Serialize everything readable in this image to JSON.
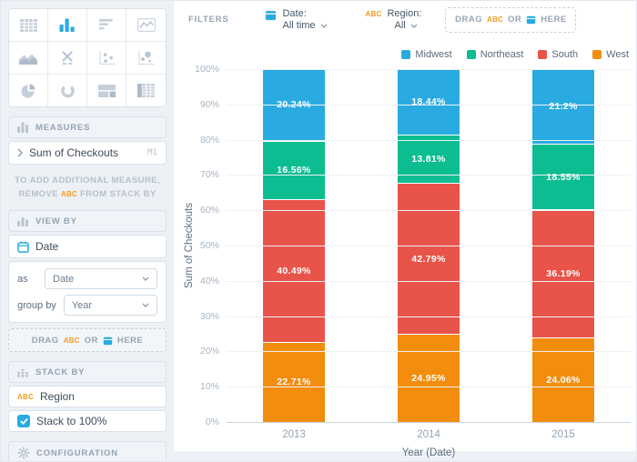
{
  "colors": {
    "accent_blue": "#29abe2",
    "accent_orange": "#f59b22",
    "midwest": "#29abe2",
    "northeast": "#0dbd92",
    "south": "#e8534a",
    "west": "#f28d0e"
  },
  "sidebar": {
    "chart_types": [
      "table",
      "bar",
      "horizontal-bar",
      "line",
      "area",
      "boxplot",
      "scatter",
      "bubble",
      "pie",
      "donut",
      "treemap",
      "pivot-table"
    ],
    "active_chart_type": "bar",
    "measures": {
      "title": "MEASURES",
      "item": "Sum of Checkouts",
      "badge": "M1"
    },
    "note": {
      "line1": "TO ADD ADDITIONAL MEASURE,",
      "line2_pre": "REMOVE",
      "abc": "ABC",
      "line2_post": "FROM STACK BY"
    },
    "view_by": {
      "title": "VIEW BY",
      "field": "Date",
      "as_label": "as",
      "as_value": "Date",
      "group_by_label": "group by",
      "group_by_value": "Year",
      "drop": {
        "drag": "DRAG",
        "abc": "ABC",
        "or": "OR",
        "here": "HERE"
      }
    },
    "stack_by": {
      "title": "STACK BY",
      "abc": "ABC",
      "field": "Region",
      "checkbox_label": "Stack to 100%",
      "checked": true
    },
    "configuration": {
      "title": "CONFIGURATION"
    }
  },
  "filters_bar": {
    "title": "FILTERS",
    "date_filter": {
      "label": "Date:",
      "value": "All time"
    },
    "region_filter": {
      "abc": "ABC",
      "label": "Region:",
      "value": "All"
    },
    "drop": {
      "drag": "DRAG",
      "abc": "ABC",
      "or": "OR",
      "here": "HERE"
    }
  },
  "chart_data": {
    "type": "bar",
    "stacked_to_100": true,
    "categories": [
      "2013",
      "2014",
      "2015"
    ],
    "series": [
      {
        "name": "Midwest",
        "color": "#29abe2",
        "values": [
          20.24,
          18.44,
          21.2
        ],
        "labels": [
          "20.24%",
          "18.44%",
          "21.2%"
        ]
      },
      {
        "name": "Northeast",
        "color": "#0dbd92",
        "values": [
          16.56,
          13.81,
          18.55
        ],
        "labels": [
          "16.56%",
          "13.81%",
          "18.55%"
        ]
      },
      {
        "name": "South",
        "color": "#e8534a",
        "values": [
          40.49,
          42.79,
          36.19
        ],
        "labels": [
          "40.49%",
          "42.79%",
          "36.19%"
        ]
      },
      {
        "name": "West",
        "color": "#f28d0e",
        "values": [
          22.71,
          24.95,
          24.06
        ],
        "labels": [
          "22.71%",
          "24.95%",
          "24.06%"
        ]
      }
    ],
    "xlabel": "Year (Date)",
    "ylabel": "Sum of Checkouts",
    "ylim": [
      0,
      100
    ],
    "ytick_step": 10,
    "ytick_suffix": "%",
    "legend_position": "top-right",
    "grid": true
  }
}
